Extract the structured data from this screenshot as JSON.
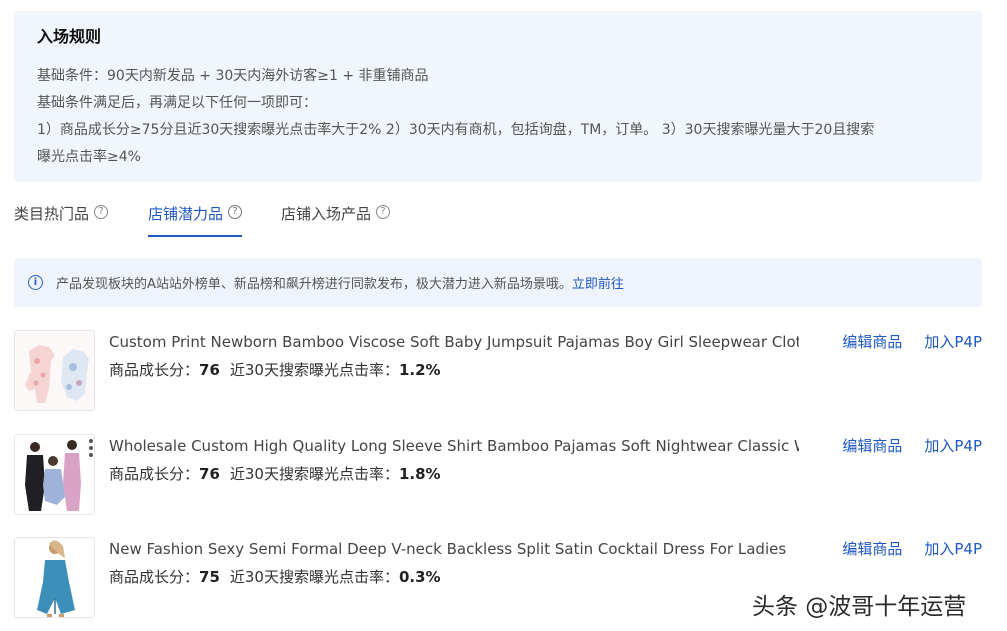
{
  "rules": {
    "title": "入场规则",
    "lines": [
      "基础条件：90天内新发品 + 30天内海外访客≥1 + 非重铺商品",
      "基础条件满足后，再满足以下任何一项即可：",
      "1）商品成长分≥75分且近30天搜索曝光点击率大于2% 2）30天内有商机，包括询盘，TM，订单。 3）30天搜索曝光量大于20且搜索",
      "曝光点击率≥4%"
    ]
  },
  "tabs": [
    {
      "label": "类目热门品",
      "help": "?"
    },
    {
      "label": "店铺潜力品",
      "help": "?"
    },
    {
      "label": "店铺入场产品",
      "help": "?"
    }
  ],
  "notice": {
    "icon": "i",
    "text": "产品发现板块的A站站外榜单、新品榜和飙升榜进行同款发布，极大潜力进入新品场景哦。",
    "link": "立即前往"
  },
  "product_labels": {
    "growth": "商品成长分：",
    "ctr": "近30天搜索曝光点击率：",
    "edit": "编辑商品",
    "p4p": "加入P4P"
  },
  "products": [
    {
      "title": "Custom Print Newborn Bamboo Viscose Soft Baby Jumpsuit Pajamas Boy Girl Sleepwear Clothes ...",
      "score": "76",
      "ctr": "1.2%"
    },
    {
      "title": "Wholesale Custom High Quality Long Sleeve Shirt Bamboo Pajamas Soft Nightwear Classic Wom...",
      "score": "76",
      "ctr": "1.8%"
    },
    {
      "title": "New Fashion Sexy Semi Formal Deep V-neck Backless Split Satin Cocktail Dress For Ladies",
      "score": "75",
      "ctr": "0.3%"
    }
  ],
  "watermark": "头条 @波哥十年运营"
}
